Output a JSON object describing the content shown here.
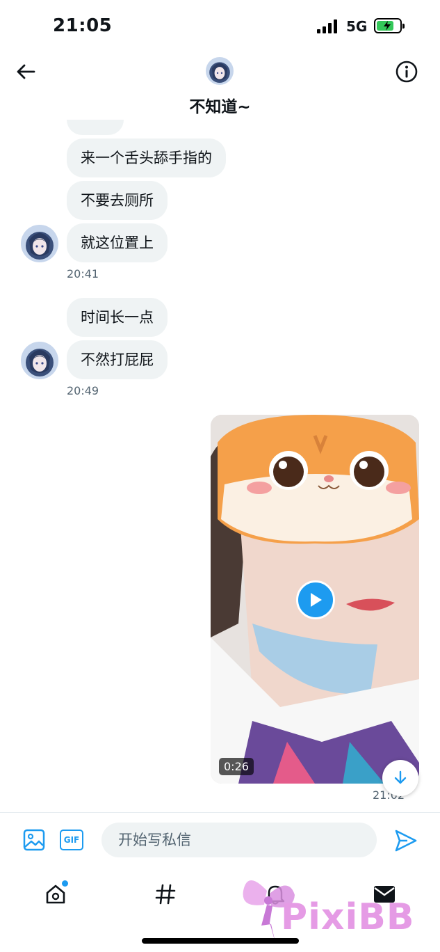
{
  "status_bar": {
    "time": "21:05",
    "network": "5G"
  },
  "header": {
    "title": "不知道~"
  },
  "messages_received": [
    {
      "text": "来一个舌头舔手指的"
    },
    {
      "text": "不要去厕所"
    },
    {
      "text": "就这位置上"
    },
    {
      "text": "时间长一点"
    },
    {
      "text": "不然打屁屁"
    }
  ],
  "timestamps": {
    "group1": "20:41",
    "group2": "20:49",
    "sent": "21:02"
  },
  "video": {
    "duration": "0:26"
  },
  "composer": {
    "placeholder": "开始写私信",
    "gif_label": "GIF"
  },
  "watermark": "PixiBB",
  "colors": {
    "accent": "#1d9bf0",
    "bubble": "#eff3f4",
    "secondary_text": "#536471"
  }
}
